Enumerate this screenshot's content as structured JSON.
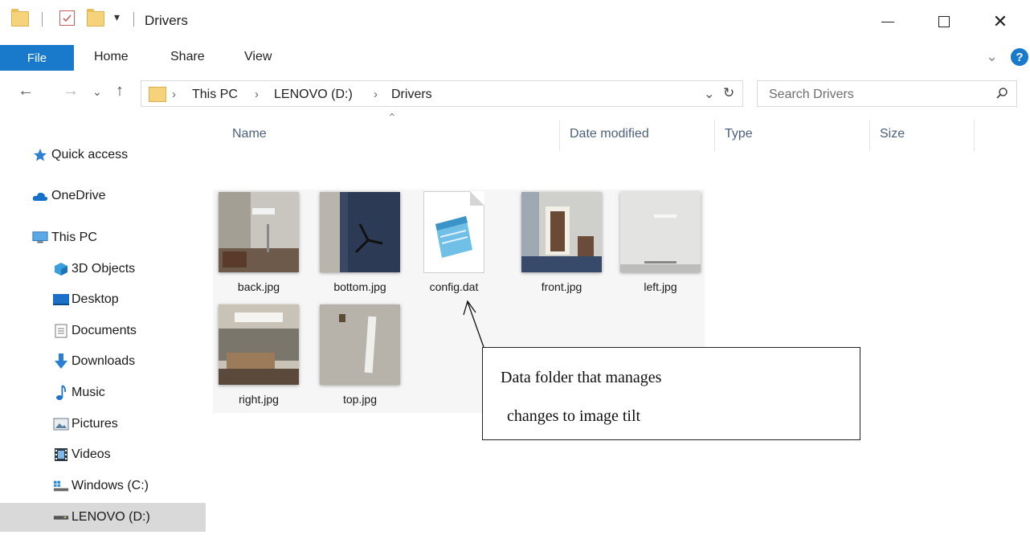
{
  "window": {
    "title": "Drivers",
    "dropdown_glyph": "▾"
  },
  "ribbon": {
    "tabs": [
      "File",
      "Home",
      "Share",
      "View"
    ]
  },
  "address": {
    "crumbs": [
      "This PC",
      "LENOVO (D:)",
      "Drivers"
    ]
  },
  "search": {
    "placeholder": "Search Drivers"
  },
  "nav": {
    "items": [
      {
        "label": "Quick access",
        "icon": "star-icon"
      },
      {
        "label": "OneDrive",
        "icon": "cloud-icon"
      },
      {
        "label": "This PC",
        "icon": "computer-icon"
      },
      {
        "label": "3D Objects",
        "icon": "cube-icon"
      },
      {
        "label": "Desktop",
        "icon": "desktop-icon"
      },
      {
        "label": "Documents",
        "icon": "documents-icon"
      },
      {
        "label": "Downloads",
        "icon": "download-arrow-icon"
      },
      {
        "label": "Music",
        "icon": "music-note-icon"
      },
      {
        "label": "Pictures",
        "icon": "pictures-icon"
      },
      {
        "label": "Videos",
        "icon": "film-icon"
      },
      {
        "label": "Windows (C:)",
        "icon": "windows-drive-icon"
      },
      {
        "label": "LENOVO (D:)",
        "icon": "drive-icon"
      }
    ]
  },
  "columns": [
    "Name",
    "Date modified",
    "Type",
    "Size"
  ],
  "files": [
    {
      "name": "back.jpg",
      "kind": "image"
    },
    {
      "name": "bottom.jpg",
      "kind": "image"
    },
    {
      "name": "config.dat",
      "kind": "document"
    },
    {
      "name": "front.jpg",
      "kind": "image"
    },
    {
      "name": "left.jpg",
      "kind": "image"
    },
    {
      "name": "right.jpg",
      "kind": "image"
    },
    {
      "name": "top.jpg",
      "kind": "image"
    }
  ],
  "annotation": {
    "line1": "Data folder that manages",
    "line2": "changes to image tilt"
  },
  "colors": {
    "accent": "#1979ca",
    "folder": "#f6d37a",
    "selected_nav": "#d9d9d9"
  }
}
